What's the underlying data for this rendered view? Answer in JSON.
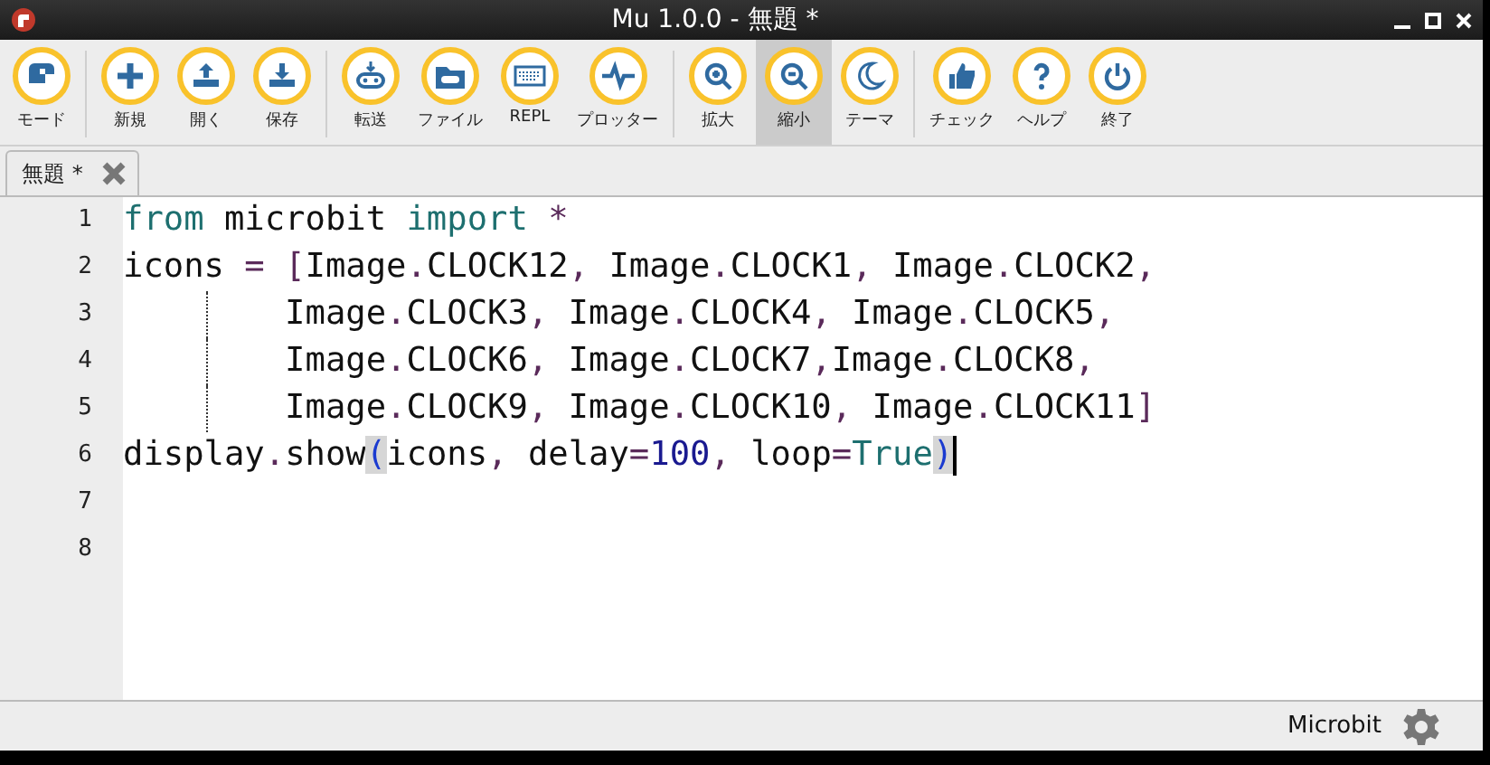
{
  "window": {
    "title": "Mu 1.0.0 - 無題 *"
  },
  "toolbar": {
    "groups": [
      [
        {
          "label": "モード",
          "selected": false
        }
      ],
      [
        {
          "label": "新規",
          "selected": false
        },
        {
          "label": "開く",
          "selected": false
        },
        {
          "label": "保存",
          "selected": false
        }
      ],
      [
        {
          "label": "転送",
          "selected": false
        },
        {
          "label": "ファイル",
          "selected": false
        },
        {
          "label": "REPL",
          "selected": false
        },
        {
          "label": "プロッター",
          "selected": false
        }
      ],
      [
        {
          "label": "拡大",
          "selected": false
        },
        {
          "label": "縮小",
          "selected": true
        },
        {
          "label": "テーマ",
          "selected": false
        }
      ],
      [
        {
          "label": "チェック",
          "selected": false
        },
        {
          "label": "ヘルプ",
          "selected": false
        },
        {
          "label": "終了",
          "selected": false
        }
      ]
    ]
  },
  "tabs": [
    {
      "label": "無題 *"
    }
  ],
  "editor": {
    "lines": [
      {
        "number": "1",
        "cursor": false,
        "indent_guide": false,
        "tokens": [
          {
            "text": "from",
            "kind": "keyword"
          },
          {
            "text": " microbit ",
            "kind": "name"
          },
          {
            "text": "import",
            "kind": "keyword"
          },
          {
            "text": " *",
            "kind": "punct"
          }
        ]
      },
      {
        "number": "2",
        "cursor": false,
        "indent_guide": false,
        "tokens": [
          {
            "text": "icons ",
            "kind": "name"
          },
          {
            "text": "=",
            "kind": "punct"
          },
          {
            "text": " [",
            "kind": "punct"
          },
          {
            "text": "Image",
            "kind": "name"
          },
          {
            "text": ".",
            "kind": "punct"
          },
          {
            "text": "CLOCK12",
            "kind": "name"
          },
          {
            "text": ",",
            "kind": "punct"
          },
          {
            "text": " Image",
            "kind": "name"
          },
          {
            "text": ".",
            "kind": "punct"
          },
          {
            "text": "CLOCK1",
            "kind": "name"
          },
          {
            "text": ",",
            "kind": "punct"
          },
          {
            "text": " Image",
            "kind": "name"
          },
          {
            "text": ".",
            "kind": "punct"
          },
          {
            "text": "CLOCK2",
            "kind": "name"
          },
          {
            "text": ",",
            "kind": "punct"
          }
        ]
      },
      {
        "number": "3",
        "cursor": false,
        "indent_guide": true,
        "tokens": [
          {
            "text": "        Image",
            "kind": "name"
          },
          {
            "text": ".",
            "kind": "punct"
          },
          {
            "text": "CLOCK3",
            "kind": "name"
          },
          {
            "text": ",",
            "kind": "punct"
          },
          {
            "text": " Image",
            "kind": "name"
          },
          {
            "text": ".",
            "kind": "punct"
          },
          {
            "text": "CLOCK4",
            "kind": "name"
          },
          {
            "text": ",",
            "kind": "punct"
          },
          {
            "text": " Image",
            "kind": "name"
          },
          {
            "text": ".",
            "kind": "punct"
          },
          {
            "text": "CLOCK5",
            "kind": "name"
          },
          {
            "text": ",",
            "kind": "punct"
          }
        ]
      },
      {
        "number": "4",
        "cursor": false,
        "indent_guide": true,
        "tokens": [
          {
            "text": "        Image",
            "kind": "name"
          },
          {
            "text": ".",
            "kind": "punct"
          },
          {
            "text": "CLOCK6",
            "kind": "name"
          },
          {
            "text": ",",
            "kind": "punct"
          },
          {
            "text": " Image",
            "kind": "name"
          },
          {
            "text": ".",
            "kind": "punct"
          },
          {
            "text": "CLOCK7",
            "kind": "name"
          },
          {
            "text": ",",
            "kind": "punct"
          },
          {
            "text": "Image",
            "kind": "name"
          },
          {
            "text": ".",
            "kind": "punct"
          },
          {
            "text": "CLOCK8",
            "kind": "name"
          },
          {
            "text": ",",
            "kind": "punct"
          }
        ]
      },
      {
        "number": "5",
        "cursor": false,
        "indent_guide": true,
        "tokens": [
          {
            "text": "        Image",
            "kind": "name"
          },
          {
            "text": ".",
            "kind": "punct"
          },
          {
            "text": "CLOCK9",
            "kind": "name"
          },
          {
            "text": ",",
            "kind": "punct"
          },
          {
            "text": " Image",
            "kind": "name"
          },
          {
            "text": ".",
            "kind": "punct"
          },
          {
            "text": "CLOCK10",
            "kind": "name"
          },
          {
            "text": ",",
            "kind": "punct"
          },
          {
            "text": " Image",
            "kind": "name"
          },
          {
            "text": ".",
            "kind": "punct"
          },
          {
            "text": "CLOCK11",
            "kind": "name"
          },
          {
            "text": "]",
            "kind": "punct"
          }
        ]
      },
      {
        "number": "6",
        "cursor": true,
        "indent_guide": false,
        "tokens": [
          {
            "text": "display",
            "kind": "name"
          },
          {
            "text": ".",
            "kind": "punct"
          },
          {
            "text": "show",
            "kind": "name"
          },
          {
            "text": "(",
            "kind": "match"
          },
          {
            "text": "icons",
            "kind": "name"
          },
          {
            "text": ",",
            "kind": "punct"
          },
          {
            "text": " delay",
            "kind": "name"
          },
          {
            "text": "=",
            "kind": "punct"
          },
          {
            "text": "100",
            "kind": "number"
          },
          {
            "text": ",",
            "kind": "punct"
          },
          {
            "text": " loop",
            "kind": "name"
          },
          {
            "text": "=",
            "kind": "punct"
          },
          {
            "text": "True",
            "kind": "keyword"
          },
          {
            "text": ")",
            "kind": "match"
          }
        ]
      },
      {
        "number": "7",
        "cursor": false,
        "indent_guide": false
      },
      {
        "number": "8",
        "cursor": false,
        "indent_guide": false
      }
    ]
  },
  "status_bar": {
    "mode": "Microbit"
  }
}
